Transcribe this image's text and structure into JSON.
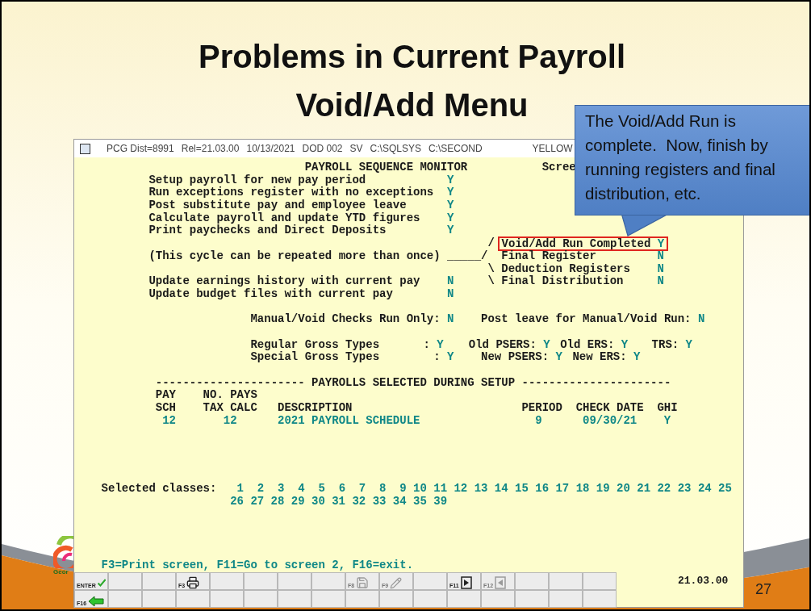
{
  "slide": {
    "title_lines": [
      "Problems in Current Payroll",
      "Void/Add Menu"
    ],
    "logo_text": "Geor",
    "page_number": "27"
  },
  "callout": {
    "text": "The Void/Add Run is complete.  Now, finish by running registers and final distribution, etc."
  },
  "terminal": {
    "status_bar": {
      "items": [
        "PCG Dist=8991",
        "Rel=21.03.00",
        "10/13/2021",
        "DOD 002",
        "SV",
        "C:\\SQLSYS",
        "C:\\SECOND"
      ],
      "scheme": "YELLOW"
    },
    "title": "PAYROLL SEQUENCE MONITOR",
    "screen_label": "Scree",
    "steps": [
      {
        "label": "Setup payroll for new pay period",
        "value": "Y"
      },
      {
        "label": "Run exceptions register with no exceptions",
        "value": "Y"
      },
      {
        "label": "Post substitute pay and employee leave",
        "value": "Y"
      },
      {
        "label": "Calculate payroll and update YTD figures",
        "value": "Y"
      },
      {
        "label": "Print paychecks and Direct Deposits",
        "value": "Y"
      }
    ],
    "cycle_note": {
      "text": "(This cycle can be repeated more than once)",
      "connector": "_____/"
    },
    "branch_steps": [
      {
        "prefix": "/",
        "label": "Void/Add Run Completed",
        "value": "Y",
        "highlighted": true
      },
      {
        "label": "Final Register",
        "value": "N",
        "highlighted": false
      },
      {
        "prefix": "\\",
        "label": "Deduction Registers",
        "value": "N",
        "highlighted": false
      },
      {
        "prefix": "\\",
        "label": "Final Distribution",
        "value": "N",
        "highlighted": false
      }
    ],
    "update_steps": [
      {
        "label": "Update earnings history with current pay",
        "value": "N"
      },
      {
        "label": "Update budget files with current pay",
        "value": "N"
      }
    ],
    "run_flags": [
      {
        "label": "Manual/Void Checks Run Only:",
        "value": "N"
      },
      {
        "label": "Post leave for Manual/Void Run:",
        "value": "N"
      }
    ],
    "gross_types": [
      {
        "label": "Regular Gross Types",
        "separator": ":",
        "value": "Y",
        "funds": [
          {
            "label": "Old PSERS:",
            "value": "Y"
          },
          {
            "label": "Old ERS:",
            "value": "Y"
          },
          {
            "label": "TRS:",
            "value": "Y"
          }
        ]
      },
      {
        "label": "Special Gross Types",
        "separator": ":",
        "value": "Y",
        "funds": [
          {
            "label": "New PSERS:",
            "value": "Y"
          },
          {
            "label": "New ERS:",
            "value": "Y"
          }
        ]
      }
    ],
    "section_heading": "---------------------- PAYROLLS SELECTED DURING SETUP ----------------------",
    "table": {
      "columns": [
        {
          "lines": [
            "PAY",
            "SCH"
          ]
        },
        {
          "lines": [
            "NO. PAYS",
            "TAX CALC"
          ]
        },
        {
          "lines": [
            "DESCRIPTION"
          ]
        },
        {
          "lines": [
            "PERIOD"
          ]
        },
        {
          "lines": [
            "CHECK DATE"
          ]
        },
        {
          "lines": [
            "GHI"
          ]
        }
      ],
      "rows": [
        [
          "12",
          "12",
          "2021 PAYROLL SCHEDULE",
          "9",
          "09/30/21",
          "Y"
        ]
      ]
    },
    "classes": {
      "label": "Selected classes:",
      "values": [
        "1",
        "2",
        "3",
        "4",
        "5",
        "6",
        "7",
        "8",
        "9",
        "10",
        "11",
        "12",
        "13",
        "14",
        "15",
        "16",
        "17",
        "18",
        "19",
        "20",
        "21",
        "22",
        "23",
        "24",
        "25",
        "26",
        "27",
        "28",
        "29",
        "30",
        "31",
        "32",
        "33",
        "34",
        "35",
        "39"
      ]
    },
    "help_line": "F3=Print screen, F11=Go to screen 2, F16=exit.",
    "function_keys": [
      [
        {
          "kind": "enter",
          "label": "ENTER",
          "disabled": false
        },
        {
          "kind": "blank"
        },
        {
          "kind": "blank"
        },
        {
          "kind": "print",
          "label": "F3",
          "disabled": false
        },
        {
          "kind": "blank"
        },
        {
          "kind": "blank"
        },
        {
          "kind": "blank"
        },
        {
          "kind": "blank"
        },
        {
          "kind": "save",
          "label": "F8",
          "disabled": true
        },
        {
          "kind": "edit",
          "label": "F9",
          "disabled": true
        },
        {
          "kind": "blank"
        },
        {
          "kind": "next",
          "label": "F11",
          "disabled": false
        },
        {
          "kind": "previous",
          "label": "F12",
          "disabled": true
        },
        {
          "kind": "blank"
        },
        {
          "kind": "blank"
        },
        {
          "kind": "blank"
        }
      ],
      [
        {
          "kind": "exit",
          "label": "F16",
          "disabled": false
        },
        {
          "kind": "blank"
        },
        {
          "kind": "blank"
        },
        {
          "kind": "blank"
        },
        {
          "kind": "blank"
        },
        {
          "kind": "blank"
        },
        {
          "kind": "blank"
        },
        {
          "kind": "blank"
        },
        {
          "kind": "blank"
        },
        {
          "kind": "blank"
        },
        {
          "kind": "blank"
        },
        {
          "kind": "blank"
        },
        {
          "kind": "blank"
        },
        {
          "kind": "blank"
        },
        {
          "kind": "blank"
        },
        {
          "kind": "blank"
        }
      ]
    ],
    "version": "21.03.00"
  }
}
